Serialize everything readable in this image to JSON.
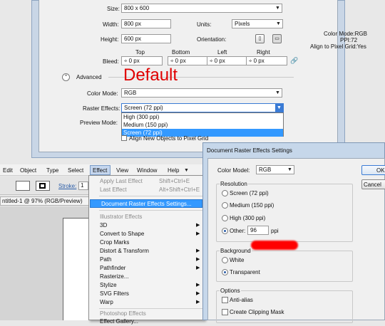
{
  "new_doc": {
    "size_label": "Size:",
    "size_value": "800 x 600",
    "width_label": "Width:",
    "width_value": "800 px",
    "units_label": "Units:",
    "units_value": "Pixels",
    "height_label": "Height:",
    "height_value": "600 px",
    "orientation_label": "Orientation:",
    "bleed_label": "Bleed:",
    "bleed_headers": [
      "Top",
      "Bottom",
      "Left",
      "Right"
    ],
    "bleed_values": [
      "0 px",
      "0 px",
      "0 px",
      "0 px"
    ],
    "advanced_label": "Advanced",
    "color_mode_label": "Color Mode:",
    "color_mode_value": "RGB",
    "raster_label": "Raster Effects:",
    "raster_value": "Screen (72 ppi)",
    "preview_label": "Preview Mode:",
    "raster_options": [
      "High (300 ppi)",
      "Medium (150 ppi)",
      "Screen (72 ppi)"
    ],
    "align_text": "Align New Objects to Pixel Grid",
    "info": [
      "Color Mode:RGB",
      "PPI:72",
      "Align to Pixel Grid:Yes"
    ],
    "annotation": "Default"
  },
  "menubar": {
    "items": [
      "Edit",
      "Object",
      "Type",
      "Select",
      "Effect",
      "View",
      "Window",
      "Help"
    ]
  },
  "toolbar": {
    "stroke_label": "Stroke:",
    "stroke_value": "1",
    "doc_tab": "ntitled-1 @ 97% (RGB/Preview)"
  },
  "effect_menu": {
    "apply_last": "Apply Last Effect",
    "apply_last_sc": "Shift+Ctrl+E",
    "last_effect": "Last Effect",
    "last_effect_sc": "Alt+Shift+Ctrl+E",
    "doc_raster": "Document Raster Effects Settings...",
    "illustrator_header": "Illustrator Effects",
    "illustrator_items": [
      "3D",
      "Convert to Shape",
      "Crop Marks",
      "Distort & Transform",
      "Path",
      "Pathfinder",
      "Rasterize...",
      "Stylize",
      "SVG Filters",
      "Warp"
    ],
    "photoshop_header": "Photoshop Effects",
    "photoshop_items": [
      "Effect Gallery..."
    ]
  },
  "raster_dialog": {
    "title": "Document Raster Effects Settings",
    "color_model_label": "Color Model:",
    "color_model_value": "RGB",
    "ok": "OK",
    "cancel": "Cancel",
    "resolution_label": "Resolution",
    "res_options": [
      "Screen (72 ppi)",
      "Medium (150 ppi)",
      "High (300 ppi)",
      "Other:"
    ],
    "other_value": "96",
    "ppi": "ppi",
    "background_label": "Background",
    "bg_options": [
      "White",
      "Transparent"
    ],
    "options_label": "Options",
    "anti_alias": "Anti-alias",
    "clipping_mask": "Create Clipping Mask"
  },
  "colors": {
    "highlight": "#3399ff",
    "annotation_red": "#e00000",
    "blob_red": "#ff0000"
  }
}
